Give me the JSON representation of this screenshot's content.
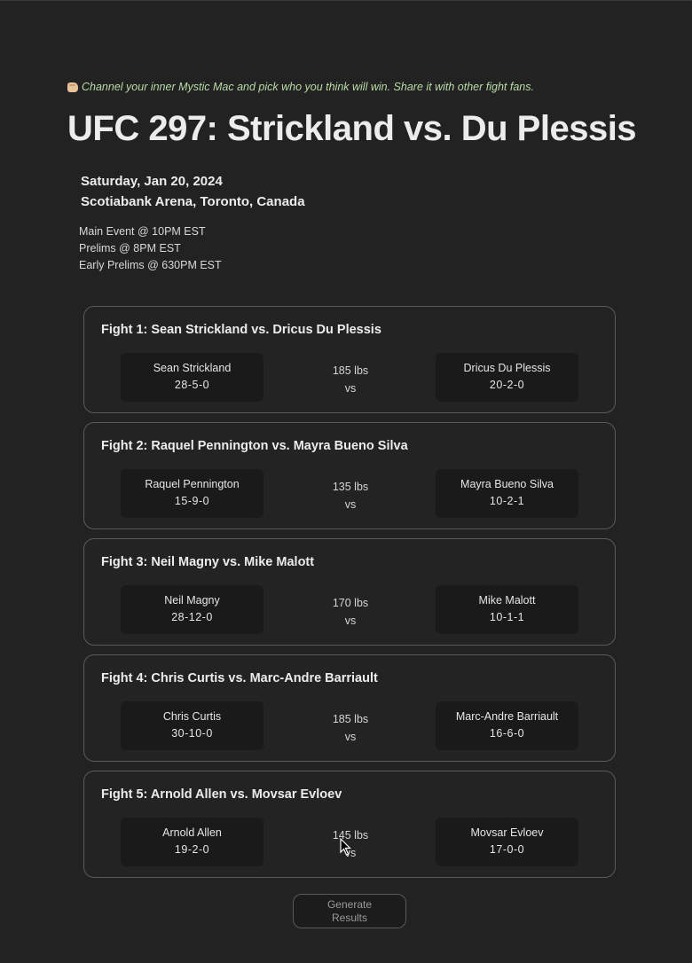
{
  "header": {
    "tagline": "Channel your inner Mystic Mac and pick who you think will win. Share it with other fight fans.",
    "tagline_icon": "fist-bump-icon",
    "title": "UFC 297: Strickland vs. Du Plessis",
    "date": "Saturday, Jan 20, 2024",
    "venue": "Scotiabank Arena, Toronto, Canada",
    "times": [
      "Main Event @ 10PM EST",
      "Prelims @ 8PM EST",
      "Early Prelims @ 630PM EST"
    ]
  },
  "fights": [
    {
      "title": "Fight 1: Sean Strickland vs. Dricus Du Plessis",
      "weight": "185 lbs",
      "vs": "vs",
      "fighter1": {
        "name": "Sean Strickland",
        "record": "28-5-0"
      },
      "fighter2": {
        "name": "Dricus Du Plessis",
        "record": "20-2-0"
      }
    },
    {
      "title": "Fight 2: Raquel Pennington vs. Mayra Bueno Silva",
      "weight": "135 lbs",
      "vs": "vs",
      "fighter1": {
        "name": "Raquel Pennington",
        "record": "15-9-0"
      },
      "fighter2": {
        "name": "Mayra Bueno Silva",
        "record": "10-2-1"
      }
    },
    {
      "title": "Fight 3: Neil Magny vs. Mike Malott",
      "weight": "170 lbs",
      "vs": "vs",
      "fighter1": {
        "name": "Neil Magny",
        "record": "28-12-0"
      },
      "fighter2": {
        "name": "Mike Malott",
        "record": "10-1-1"
      }
    },
    {
      "title": "Fight 4: Chris Curtis vs. Marc-Andre Barriault",
      "weight": "185 lbs",
      "vs": "vs",
      "fighter1": {
        "name": "Chris Curtis",
        "record": "30-10-0"
      },
      "fighter2": {
        "name": "Marc-Andre Barriault",
        "record": "16-6-0"
      }
    },
    {
      "title": "Fight 5: Arnold Allen vs. Movsar Evloev",
      "weight": "145 lbs",
      "vs": "vs",
      "fighter1": {
        "name": "Arnold Allen",
        "record": "19-2-0"
      },
      "fighter2": {
        "name": "Movsar Evloev",
        "record": "17-0-0"
      }
    }
  ],
  "actions": {
    "generate_label": "Generate Results"
  },
  "colors": {
    "background": "#222222",
    "tagline": "#b9dba6",
    "card_border": "#5a5a5a",
    "fighter_bg": "#1a1a1a"
  }
}
